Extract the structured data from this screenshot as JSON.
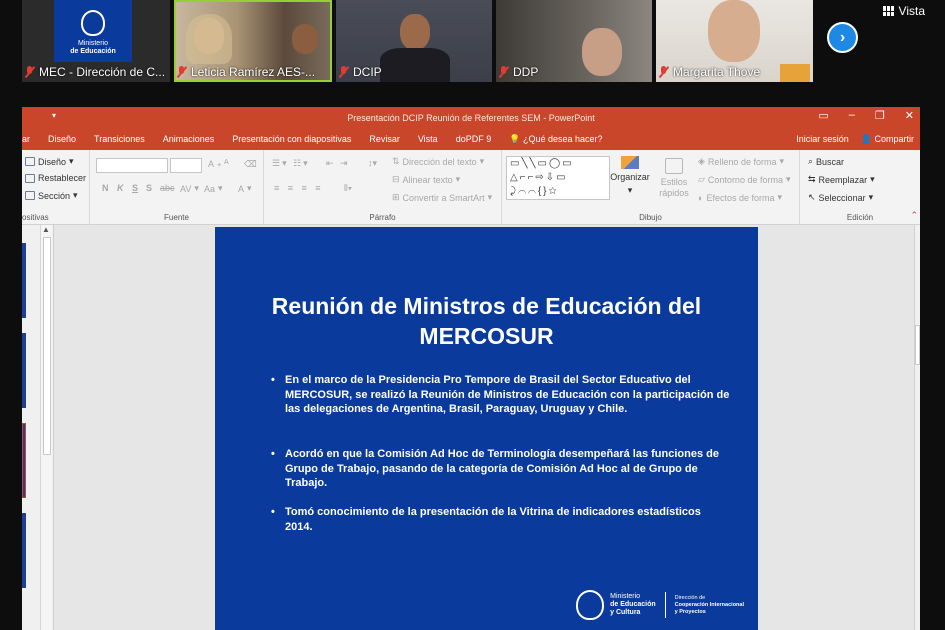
{
  "meeting": {
    "view_label": "Vista",
    "participants": [
      {
        "name": "MEC - Dirección de C...",
        "muted": true
      },
      {
        "name": "Leticia Ramírez AES-...",
        "muted": true,
        "active": true
      },
      {
        "name": "DCIP",
        "muted": true
      },
      {
        "name": "DDP",
        "muted": true
      },
      {
        "name": "Margarita Thove",
        "muted": true
      }
    ],
    "first_tile_logo": {
      "line1": "Ministerio",
      "line2": "de Educación"
    }
  },
  "ppt": {
    "window_title": "Presentación DCIP Reunión de Referentes SEM - PowerPoint",
    "tabs": [
      "ar",
      "Diseño",
      "Transiciones",
      "Animaciones",
      "Presentación con diapositivas",
      "Revisar",
      "Vista",
      "doPDF 9"
    ],
    "tell_me": "¿Qué desea hacer?",
    "sign_in": "Iniciar sesión",
    "share": "Compartir",
    "ribbon": {
      "slides": {
        "diseno": "Diseño",
        "restablecer": "Restablecer",
        "seccion": "Sección",
        "label": "ositivas"
      },
      "font": {
        "label": "Fuente",
        "bold": "N",
        "italic": "K",
        "underline": "S",
        "strike": "S",
        "abc": "abc",
        "av": "AV",
        "aa": "Aa",
        "grow": "A",
        "shrink": "A"
      },
      "paragraph": {
        "label": "Párrafo",
        "direccion": "Dirección del texto",
        "alinear": "Alinear texto",
        "convertir": "Convertir a SmartArt"
      },
      "drawing": {
        "label": "Dibujo",
        "organizar": "Organizar",
        "estilos": "Estilos rápidos",
        "relleno": "Relleno de forma",
        "contorno": "Contorno de forma",
        "efectos": "Efectos de forma"
      },
      "editing": {
        "label": "Edición",
        "buscar": "Buscar",
        "reemplazar": "Reemplazar",
        "seleccionar": "Seleccionar"
      }
    },
    "slide": {
      "title_line1": "Reunión de Ministros de Educación del",
      "title_line2": "MERCOSUR",
      "bullets": [
        "En el marco de la Presidencia Pro Tempore de Brasil del Sector Educativo del MERCOSUR, se realizó la Reunión de Ministros de Educación con la participación de las delegaciones de Argentina, Brasil, Paraguay, Uruguay y Chile.",
        "Acordó en que la Comisión Ad Hoc de Terminología desempeñará las funciones de Grupo de Trabajo, pasando de la categoría de Comisión Ad Hoc al de Grupo de Trabajo.",
        "Tomó conocimiento de la presentación de la Vitrina de indicadores estadísticos 2014."
      ],
      "footer_logo": {
        "ministry_l1": "Ministerio",
        "ministry_l2": "de Educación",
        "ministry_l3": "y Cultura",
        "dept_l1": "Dirección de",
        "dept_l2": "Cooperación Internacional",
        "dept_l3": "y Proyectos"
      }
    }
  }
}
